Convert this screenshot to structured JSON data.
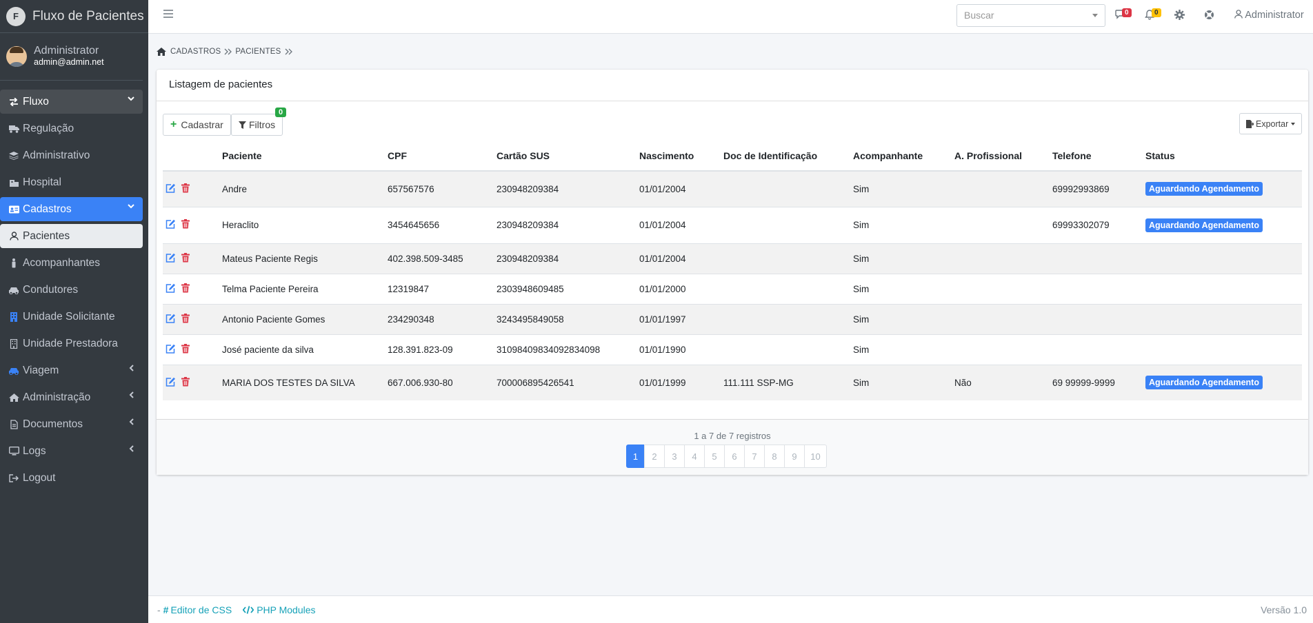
{
  "brand": {
    "logo_letter": "F",
    "title": "Fluxo de Pacientes"
  },
  "user": {
    "name": "Administrator",
    "email": "admin@admin.net"
  },
  "sidebar": {
    "items": [
      {
        "label": "Fluxo",
        "icon": "exchange-icon"
      },
      {
        "label": "Regulação",
        "icon": "truck-icon"
      },
      {
        "label": "Administrativo",
        "icon": "layers-icon"
      },
      {
        "label": "Hospital",
        "icon": "hospital-icon"
      },
      {
        "label": "Cadastros",
        "icon": "id-card-icon"
      },
      {
        "label": "Pacientes",
        "icon": "user-icon"
      },
      {
        "label": "Acompanhantes",
        "icon": "person-icon"
      },
      {
        "label": "Condutores",
        "icon": "car-icon"
      },
      {
        "label": "Unidade Solicitante",
        "icon": "building-icon"
      },
      {
        "label": "Unidade Prestadora",
        "icon": "building-icon"
      },
      {
        "label": "Viagem",
        "icon": "car-icon"
      },
      {
        "label": "Administração",
        "icon": "home-icon"
      },
      {
        "label": "Documentos",
        "icon": "file-icon"
      },
      {
        "label": "Logs",
        "icon": "desktop-icon"
      },
      {
        "label": "Logout",
        "icon": "logout-icon"
      }
    ]
  },
  "topbar": {
    "search_placeholder": "Buscar",
    "messages_count": "0",
    "notifications_count": "0",
    "user_label": "Administrator"
  },
  "breadcrumb": {
    "level1": "CADASTROS",
    "level2": "PACIENTES"
  },
  "card": {
    "title": "Listagem de pacientes",
    "add_label": "Cadastrar",
    "filters_label": "Filtros",
    "filters_count": "0",
    "export_label": "Exportar"
  },
  "table": {
    "headers": [
      "Paciente",
      "CPF",
      "Cartão SUS",
      "Nascimento",
      "Doc de Identificação",
      "Acompanhante",
      "A. Profissional",
      "Telefone",
      "Status"
    ],
    "rows": [
      [
        "Andre",
        "657567576",
        "230948209384",
        "01/01/2004",
        "",
        "Sim",
        "",
        "69992993869",
        "Aguardando Agendamento"
      ],
      [
        "Heraclito",
        "3454645656",
        "230948209384",
        "01/01/2004",
        "",
        "Sim",
        "",
        "69993302079",
        "Aguardando Agendamento"
      ],
      [
        "Mateus Paciente Regis",
        "402.398.509-3485",
        "230948209384",
        "01/01/2004",
        "",
        "Sim",
        "",
        "",
        ""
      ],
      [
        "Telma Paciente Pereira",
        "12319847",
        "2303948609485",
        "01/01/2000",
        "",
        "Sim",
        "",
        "",
        ""
      ],
      [
        "Antonio Paciente Gomes",
        "234290348",
        "3243495849058",
        "01/01/1997",
        "",
        "Sim",
        "",
        "",
        ""
      ],
      [
        "José paciente da silva",
        "128.391.823-09",
        "31098409834092834098",
        "01/01/1990",
        "",
        "Sim",
        "",
        "",
        ""
      ],
      [
        "MARIA DOS TESTES DA SILVA",
        "667.006.930-80",
        "700006895426541",
        "01/01/1999",
        "111.111 SSP-MG",
        "Sim",
        "Não",
        "69 99999-9999",
        "Aguardando Agendamento"
      ]
    ]
  },
  "pagination": {
    "records_text": "1 a 7 de 7 registros",
    "pages": [
      "1",
      "2",
      "3",
      "4",
      "5",
      "6",
      "7",
      "8",
      "9",
      "10"
    ]
  },
  "footer": {
    "dash": "-",
    "css_editor": "Editor de CSS",
    "php_modules": "PHP Modules",
    "version": "Versão 1.0"
  },
  "colors": {
    "sidebar_bg": "#343a40",
    "accent": "#3a82f6",
    "success": "#28a745",
    "danger": "#dc3545",
    "warning": "#ffc107"
  }
}
